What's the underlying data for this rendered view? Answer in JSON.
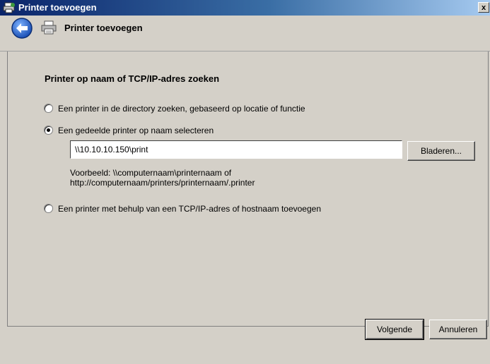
{
  "window": {
    "title": "Printer toevoegen",
    "close_glyph": "x",
    "icon": "printer-add-icon"
  },
  "header": {
    "title": "Printer toevoegen",
    "back_icon": "back-arrow-icon",
    "printer_icon": "printer-icon"
  },
  "main": {
    "section_title": "Printer op naam of TCP/IP-adres zoeken",
    "options": [
      {
        "label": "Een printer in de directory zoeken, gebaseerd op locatie of functie",
        "selected": false
      },
      {
        "label": "Een gedeelde printer op naam selecteren",
        "selected": true
      },
      {
        "label": "Een printer met behulp van een TCP/IP-adres of hostnaam toevoegen",
        "selected": false
      }
    ],
    "path_value": "\\\\10.10.10.150\\print",
    "browse_label": "Bladeren...",
    "example_line1": "Voorbeeld: \\\\computernaam\\printernaam of",
    "example_line2": "http://computernaam/printers/printernaam/.printer"
  },
  "footer": {
    "next_label": "Volgende",
    "cancel_label": "Annuleren"
  },
  "colors": {
    "titlebar_start": "#0a246a",
    "titlebar_end": "#a6caf0",
    "dialog_bg": "#d4d0c8",
    "back_button": "#2a6fd6"
  }
}
